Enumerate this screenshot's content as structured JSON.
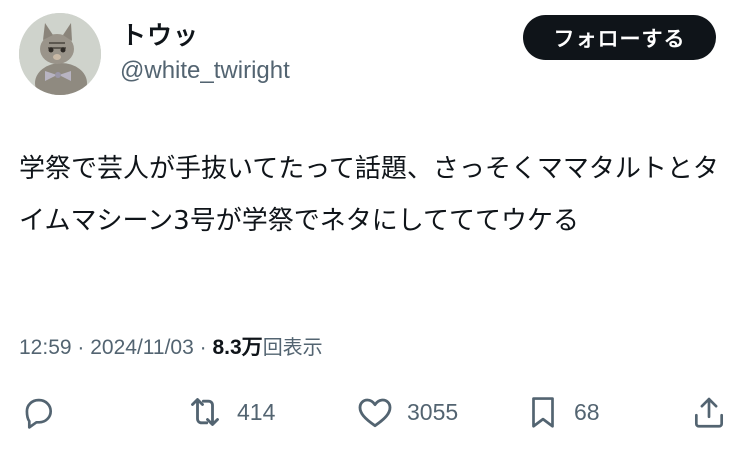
{
  "author": {
    "display_name": "トウッ",
    "handle": "@white_twiright",
    "avatar_icon": "cat-avatar-icon"
  },
  "follow_label": "フォローする",
  "tweet": {
    "text": "学祭で芸人が手抜いてたって話題、さっそくママタルトとタイムマシーン3号が学祭でネタにしてててウケる",
    "time": "12:59",
    "date": "2024/11/03",
    "separator": "·",
    "views_count": "8.3万",
    "views_label": "回表示"
  },
  "actions": {
    "reply_icon": "reply-icon",
    "retweet_icon": "retweet-icon",
    "retweet_count": "414",
    "like_icon": "heart-icon",
    "like_count": "3055",
    "bookmark_icon": "bookmark-icon",
    "bookmark_count": "68",
    "share_icon": "share-icon"
  },
  "colors": {
    "text_primary": "#0f1419",
    "text_secondary": "#536471",
    "button_bg": "#0f1419",
    "button_text": "#ffffff"
  }
}
